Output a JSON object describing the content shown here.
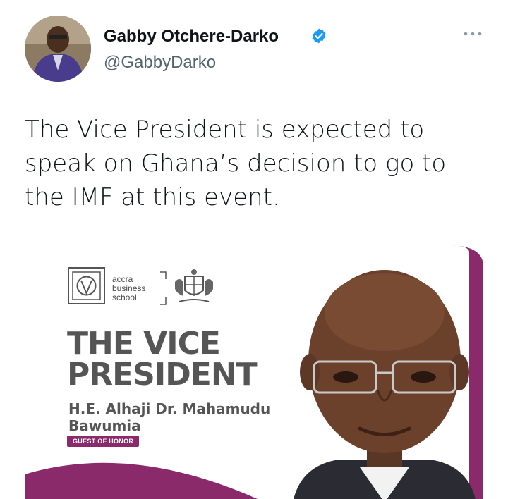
{
  "tweet": {
    "display_name": "Gabby Otchere-Darko",
    "handle": "@GabbyDarko",
    "verified": true,
    "more_icon": "more-horizontal-icon",
    "text": "The Vice President is expected to speak on Ghana’s decision to go to the IMF at this event."
  },
  "media": {
    "logo": {
      "lines": [
        "accra",
        "business",
        "school"
      ]
    },
    "title_line1": "THE VICE",
    "title_line2": "PRESIDENT",
    "name_line1": "H.E. Alhaji Dr. Mahamudu",
    "name_line2": "Bawumia",
    "badge": "GUEST OF HONOR",
    "accent_color": "#8a2a6a"
  },
  "colors": {
    "verified": "#1d9bf0",
    "handle": "#536471",
    "text": "#0f1419"
  }
}
